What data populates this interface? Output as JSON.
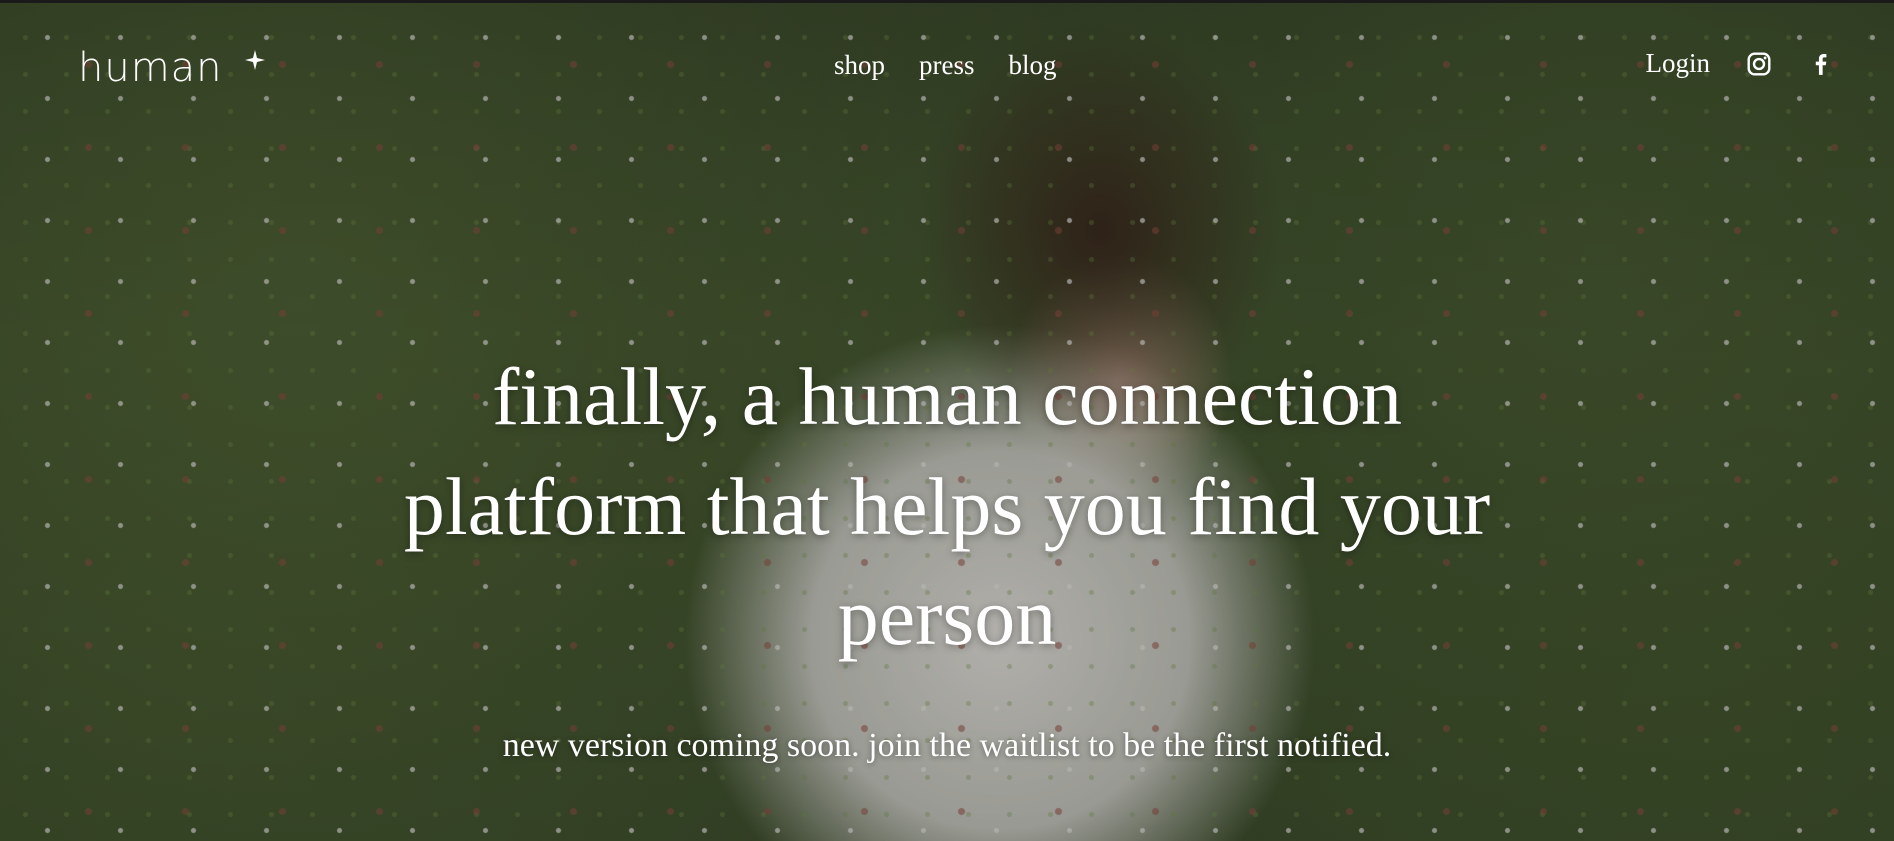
{
  "header": {
    "logo_text": "human",
    "nav": [
      {
        "label": "shop"
      },
      {
        "label": "press"
      },
      {
        "label": "blog"
      }
    ],
    "login_label": "Login",
    "social_icons": [
      "instagram-icon",
      "facebook-icon"
    ]
  },
  "hero": {
    "headline_lines": [
      "finally, a human connection",
      "platform that helps you find your",
      "person"
    ],
    "subline": "new version coming soon. join the waitlist to be the first notified."
  },
  "colors": {
    "text": "#ffffff",
    "top_border": "#1a1a1a"
  }
}
